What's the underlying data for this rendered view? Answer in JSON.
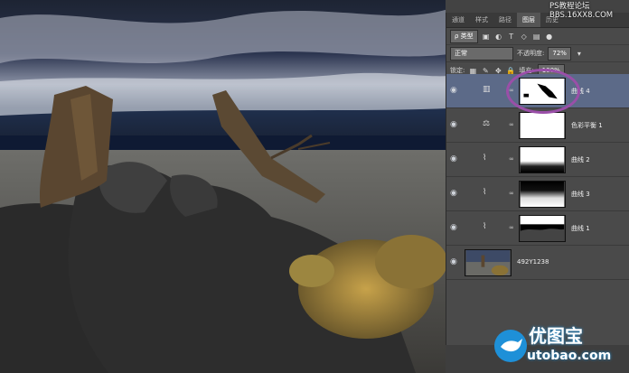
{
  "watermark": {
    "line1": "PS教程论坛",
    "line2": "BBS.16XX8.COM"
  },
  "tabs": [
    {
      "label": "通道",
      "active": false
    },
    {
      "label": "样式",
      "active": false
    },
    {
      "label": "路径",
      "active": false
    },
    {
      "label": "图层",
      "active": true
    },
    {
      "label": "历史",
      "active": false
    }
  ],
  "filter": {
    "kind": "ρ 类型"
  },
  "blend": {
    "mode": "正常",
    "opacity_label": "不透明度:",
    "opacity": "72%"
  },
  "lock": {
    "label": "锁定:",
    "fill_label": "填充:",
    "fill": "100%"
  },
  "layers": [
    {
      "name": "曲线 4",
      "selected": true,
      "adj_icon": "levels-icon"
    },
    {
      "name": "色彩平衡 1",
      "selected": false,
      "adj_icon": "balance-icon"
    },
    {
      "name": "曲线 2",
      "selected": false,
      "adj_icon": "curves-icon"
    },
    {
      "name": "曲线 3",
      "selected": false,
      "adj_icon": "curves-icon"
    },
    {
      "name": "曲线 1",
      "selected": false,
      "adj_icon": "curves-icon"
    },
    {
      "name": "492Y1238",
      "selected": false,
      "adj_icon": ""
    }
  ],
  "brand": {
    "text": "优图宝",
    "domain": "utobao.com"
  },
  "colors": {
    "selection": "#5c6a88",
    "highlight_circle": "#9a4fa8",
    "brand_blue": "#1e90d8"
  }
}
